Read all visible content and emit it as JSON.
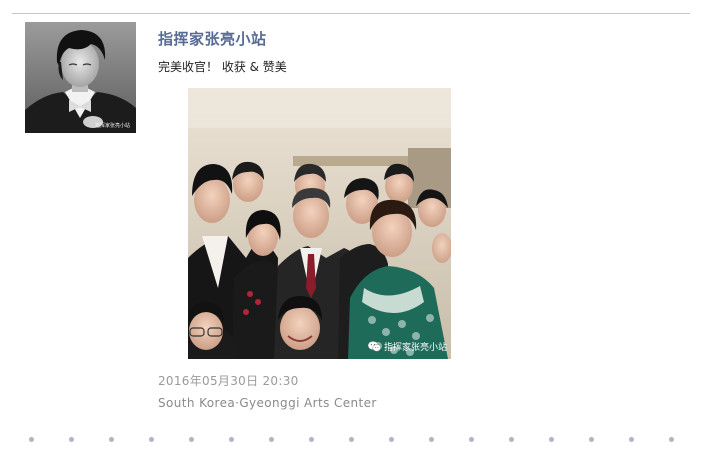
{
  "post": {
    "author_name": "指挥家张亮小站",
    "text": "完美收官！ 收获 & 赞美",
    "timestamp": "2016年05月30日 20:30",
    "location": "South Korea·Gyeonggi Arts Center"
  },
  "photo": {
    "watermark": "指挥家张亮小站",
    "watermark_icon": "wechat-icon"
  },
  "avatar": {
    "watermark": "指挥家张亮小站"
  },
  "colors": {
    "author_link": "#576b95",
    "meta_text": "#9a9a9a",
    "dot": "#b3b3c4",
    "rule": "#c6c6c6"
  }
}
